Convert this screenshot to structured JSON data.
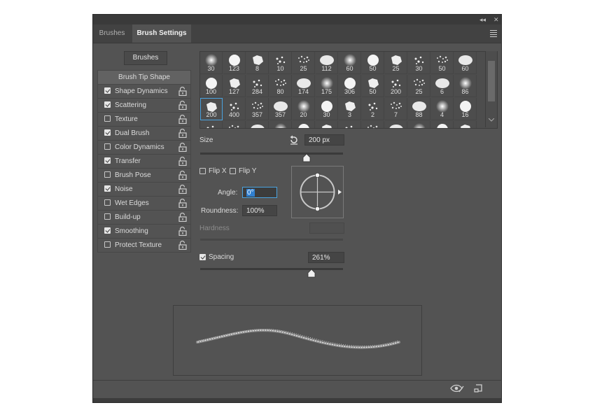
{
  "window": {
    "collapse_glyph": "◂◂",
    "close_glyph": "✕"
  },
  "tabs": [
    {
      "label": "Brushes",
      "active": false
    },
    {
      "label": "Brush Settings",
      "active": true
    }
  ],
  "brushes_button": "Brushes",
  "sidebar": {
    "header": "Brush Tip Shape",
    "items": [
      {
        "label": "Shape Dynamics",
        "checked": true
      },
      {
        "label": "Scattering",
        "checked": true
      },
      {
        "label": "Texture",
        "checked": false
      },
      {
        "label": "Dual Brush",
        "checked": true
      },
      {
        "label": "Color Dynamics",
        "checked": false
      },
      {
        "label": "Transfer",
        "checked": true
      },
      {
        "label": "Brush Pose",
        "checked": false
      },
      {
        "label": "Noise",
        "checked": true
      },
      {
        "label": "Wet Edges",
        "checked": false
      },
      {
        "label": "Build-up",
        "checked": false
      },
      {
        "label": "Smoothing",
        "checked": true
      },
      {
        "label": "Protect Texture",
        "checked": false
      }
    ]
  },
  "brush_grid": {
    "selected": "200",
    "rows": [
      [
        "30",
        "123",
        "8",
        "10",
        "25",
        "112",
        "60",
        "50",
        "25",
        "30",
        "50",
        "60"
      ],
      [
        "100",
        "127",
        "284",
        "80",
        "174",
        "175",
        "306",
        "50",
        "200",
        "25",
        "6",
        "86"
      ],
      [
        "200",
        "400",
        "357",
        "357",
        "20",
        "30",
        "3",
        "2",
        "7",
        "88",
        "4",
        "16"
      ],
      [
        "",
        "",
        "",
        "",
        "",
        "",
        "",
        "",
        "",
        "",
        "",
        ""
      ]
    ]
  },
  "size": {
    "label": "Size",
    "value": "200 px",
    "reset_icon": "reset-icon"
  },
  "flip_x": {
    "label": "Flip X",
    "checked": false
  },
  "flip_y": {
    "label": "Flip Y",
    "checked": false
  },
  "angle": {
    "label": "Angle:",
    "value": "0°"
  },
  "roundness": {
    "label": "Roundness:",
    "value": "100%"
  },
  "hardness": {
    "label": "Hardness",
    "value": ""
  },
  "spacing": {
    "label": "Spacing",
    "checked": true,
    "value": "261%"
  },
  "footer_icons": [
    "eye-icon",
    "new-preset-icon"
  ],
  "colors": {
    "panel": "#535353",
    "accent": "#4aa3df",
    "text": "#dcdcdc"
  }
}
